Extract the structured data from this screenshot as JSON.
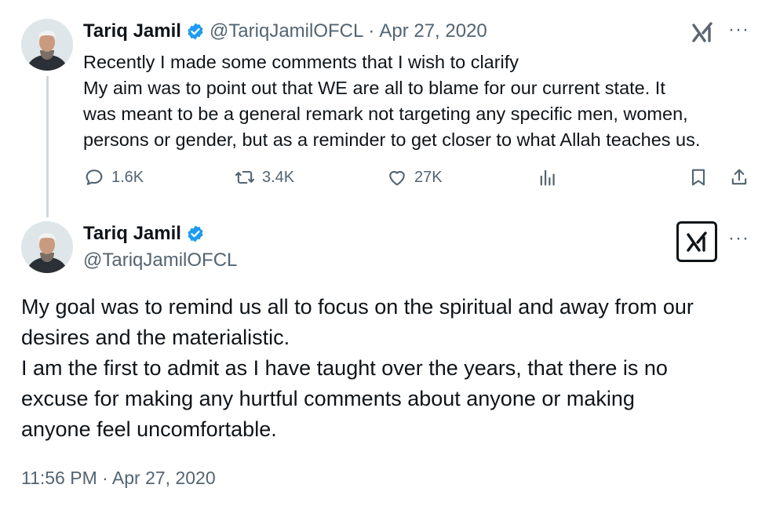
{
  "tweet1": {
    "name": "Tariq Jamil",
    "handle": "@TariqJamilOFCL",
    "separator": "·",
    "date": "Apr 27, 2020",
    "text_lines": [
      "Recently I made some comments that I wish to clarify",
      "My aim was to point out that WE are all to blame for our current state. It",
      "was meant to be a general remark not targeting any specific men, women,",
      "persons or gender, but as a reminder to get closer to what Allah teaches us."
    ],
    "replies": "1.6K",
    "reposts": "3.4K",
    "likes": "27K",
    "more": "···"
  },
  "tweet2": {
    "name": "Tariq Jamil",
    "handle": "@TariqJamilOFCL",
    "more": "···",
    "text_lines": [
      "My goal was to remind us all to focus on the spiritual and away from our",
      "desires and the materialistic.",
      "I am the first to admit as I have taught over the years, that there is no",
      "excuse for making any hurtful comments about anyone or making",
      "anyone feel uncomfortable."
    ],
    "timestamp": "11:56 PM · Apr 27, 2020"
  },
  "colors": {
    "text": "#0f1419",
    "secondary": "#536471",
    "verified": "#1d9bf0",
    "thread_line": "#cfd9de"
  },
  "icons": [
    "verified-badge-icon",
    "grok-icon",
    "more-icon",
    "reply-icon",
    "repost-icon",
    "like-icon",
    "views-icon",
    "bookmark-icon",
    "share-icon"
  ]
}
